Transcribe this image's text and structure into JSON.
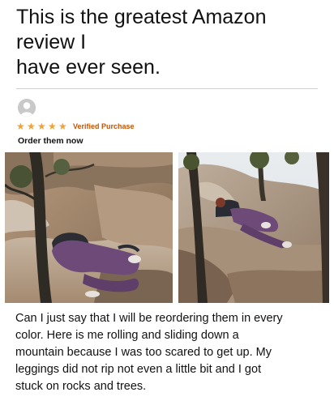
{
  "headline": {
    "lines": [
      "This is the greatest Amazon",
      "review I",
      "have ever seen."
    ]
  },
  "review": {
    "rating": 5,
    "verified_label": "Verified Purchase",
    "title": "Order them now",
    "body_lines": [
      "Can I just say that I will be reordering them in every",
      "color. Here is me rolling and sliding down a",
      "mountain because I was too scared to get up. My",
      "leggings did not rip not even a little bit and I got",
      "stuck on rocks and trees."
    ]
  },
  "colors": {
    "star": "#f1a232",
    "verified": "#c45500",
    "leggings": "#6e4a78"
  },
  "icons": {
    "avatar": "default-user-icon",
    "star": "star-icon"
  }
}
